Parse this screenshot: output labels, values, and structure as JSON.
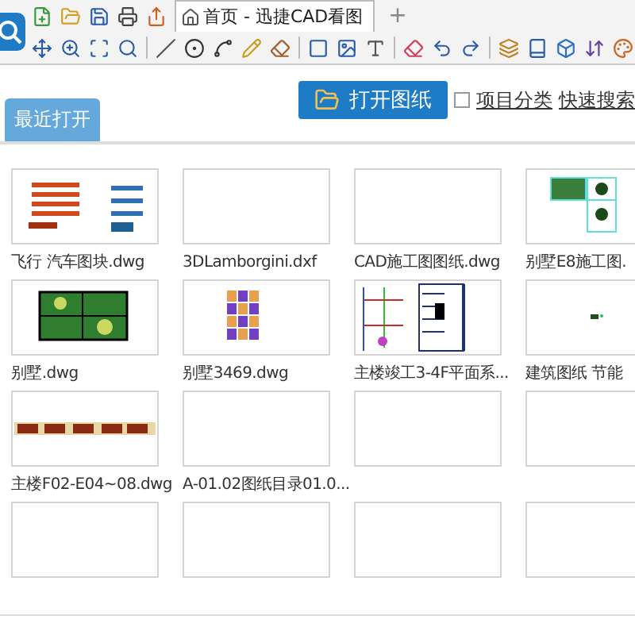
{
  "tabs": [
    {
      "label": "首页 - 迅捷CAD看图",
      "selected": true
    }
  ],
  "new_tab": "+",
  "open_button": {
    "label": "打开图纸"
  },
  "category_checkbox": {
    "label": "项目分类",
    "checked": false
  },
  "search_link": "快速搜索",
  "section_tabs": [
    {
      "label": "最近打开",
      "selected": true
    }
  ],
  "files": [
    {
      "name": "飞行 汽车图块.dwg",
      "kind": "blocks"
    },
    {
      "name": "3DLamborgini.dxf",
      "kind": "empty"
    },
    {
      "name": "CAD施工图图纸.dwg",
      "kind": "empty"
    },
    {
      "name": "别墅E8施工图.",
      "kind": "plan"
    },
    {
      "name": "别墅.dwg",
      "kind": "grid"
    },
    {
      "name": "别墅3469.dwg",
      "kind": "tiles"
    },
    {
      "name": "主楼竣工3-4F平面系...",
      "kind": "section"
    },
    {
      "name": "建筑图纸 节能",
      "kind": "dot"
    },
    {
      "name": "主楼F02-E04~08.dwg",
      "kind": "strip"
    },
    {
      "name": "A-01.02图纸目录01.0...",
      "kind": "empty"
    },
    {
      "kind": "empty"
    },
    {
      "kind": "empty"
    },
    {
      "kind": "empty"
    },
    {
      "kind": "empty"
    },
    {
      "kind": "empty"
    },
    {
      "kind": "empty"
    }
  ]
}
